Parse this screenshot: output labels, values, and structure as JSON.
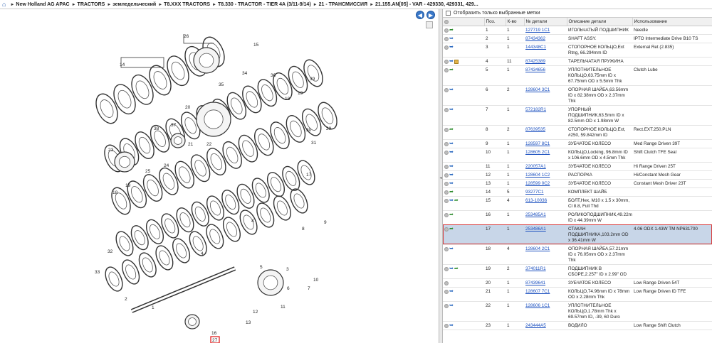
{
  "breadcrumb": {
    "home_icon": "home-icon",
    "items": [
      "New Holland AG APAC",
      "TRACTORS",
      "земледельческий",
      "T8.XXX TRACTORS",
      "T8.330 - TRACTOR - TIER 4A (3/11-9/14)",
      "21 - ТРАНСМИССИЯ",
      "21.155.AN[05] - VAR - 429330, 429331, 429..."
    ]
  },
  "diagram": {
    "labels": [
      "26",
      "15",
      "14",
      "36",
      "34",
      "35",
      "39",
      "19",
      "18",
      "20",
      "30",
      "37",
      "38",
      "22",
      "21",
      "31",
      "23",
      "25",
      "24",
      "29",
      "19",
      "18",
      "17",
      "9",
      "8",
      "4",
      "5",
      "6",
      "7",
      "32",
      "3",
      "33",
      "4",
      "10",
      "1",
      "2",
      "11",
      "12",
      "13",
      "16",
      "27"
    ],
    "highlighted_label": "27"
  },
  "nav": {
    "back": "◀",
    "forward": "▶"
  },
  "panel": {
    "filter_label": "Отобразить только выбранные метки",
    "columns": [
      "",
      "Поз.",
      "К-во",
      "№ детали",
      "Описание детали",
      "Использование"
    ]
  },
  "rows": [
    {
      "pos": "1",
      "qty": "1",
      "part": "127719 1C1",
      "desc": "ИГОЛЬЧАТЫЙ ПОДШИПНИК",
      "use": "Needle",
      "icons": "circ,arr"
    },
    {
      "pos": "2",
      "qty": "1",
      "part": "87434362",
      "desc": "SHAFT ASSY.",
      "use": "IPTO Intermediate Drive B10 TS",
      "icons": "circ,blue"
    },
    {
      "pos": "3",
      "qty": "1",
      "part": "144348C1",
      "desc": "СТОПОРНОЕ КОЛЬЦО,Ext Rtng, 66.294mm ID",
      "use": "External Ret (2.835)",
      "icons": "circ,blue"
    },
    {
      "pos": "4",
      "qty": "11",
      "part": "87425389",
      "desc": "ТАРЕЛЬЧАТАЯ ПРУЖИНА",
      "use": "",
      "icons": "circ,blue,box"
    },
    {
      "pos": "5",
      "qty": "1",
      "part": "87434656",
      "desc": "УПЛОТНИТЕЛЬНОЕ КОЛЬЦО,63.75mm ID x 67.75mm OD x 5.5mm Thk",
      "use": "Clutch Lube",
      "icons": "circ,arr"
    },
    {
      "pos": "6",
      "qty": "2",
      "part": "128604 3C1",
      "desc": "ОПОРНАЯ ШАЙБА,63.56mm ID x 82.38mm OD x 2.37mm Thk",
      "use": "",
      "icons": "circ,blue"
    },
    {
      "pos": "7",
      "qty": "1",
      "part": "572182R1",
      "desc": "УПОРНЫЙ ПОДШИПНИК,63.5mm ID x 82.5mm OD x 1.98mm W",
      "use": "",
      "icons": "circ,blue"
    },
    {
      "pos": "8",
      "qty": "2",
      "part": "87639535",
      "desc": "СТОПОРНОЕ КОЛЬЦО,Ext, #250, 59.842mm ID",
      "use": "Rect.EXT.250.PLN",
      "icons": "circ,arr"
    },
    {
      "pos": "9",
      "qty": "1",
      "part": "128597 8C1",
      "desc": "ЗУБЧАТОЕ КОЛЕСО",
      "use": "Med Range Driven 39T",
      "icons": "circ,blue"
    },
    {
      "pos": "10",
      "qty": "1",
      "part": "128605 2C1",
      "desc": "КОЛЬЦО,Locking, 96.8mm ID x 106.6mm OD x 4.5mm Thk",
      "use": "Shift Clutch TFE Seal",
      "icons": "circ,blue"
    },
    {
      "pos": "11",
      "qty": "1",
      "part": "220057A1",
      "desc": "ЗУБЧАТОЕ КОЛЕСО",
      "use": "Hi Range Driven 25T",
      "icons": "circ,blue"
    },
    {
      "pos": "12",
      "qty": "1",
      "part": "128604 1C2",
      "desc": "РАСПОРКА",
      "use": "Hi/Constant Mesh Gear",
      "icons": "circ,blue"
    },
    {
      "pos": "13",
      "qty": "1",
      "part": "128599 0C2",
      "desc": "ЗУБЧАТОЕ КОЛЕСО",
      "use": "Constant Mesh Driver 23T",
      "icons": "circ,blue"
    },
    {
      "pos": "14",
      "qty": "5",
      "part": "93277C1",
      "desc": "КОМПЛЕКТ ШАЙБ",
      "use": "",
      "icons": "circ,arr"
    },
    {
      "pos": "15",
      "qty": "4",
      "part": "613-10036",
      "desc": "БОЛТ,Hex, M10 x 1.5 x 30mm, Cl 8.8, Full Thd",
      "use": "",
      "icons": "circ,blue,arr"
    },
    {
      "pos": "16",
      "qty": "1",
      "part": "253485A1",
      "desc": "РОЛИКОПОДШИПНИК,49.22mm ID x 44.39mm W",
      "use": "",
      "icons": "circ,arr"
    },
    {
      "pos": "17",
      "qty": "1",
      "part": "253486A1",
      "desc": "СТАКАН ПОДШИПНИКА,103.2mm OD x 36.41mm W",
      "use": "4.06 ODX 1.43W TM NP631700",
      "icons": "circ,arr",
      "selected": true
    },
    {
      "pos": "18",
      "qty": "4",
      "part": "128604 2C1",
      "desc": "ОПОРНАЯ ШАЙБА,57.21mm ID x 76.05mm OD x 2.37mm Thk",
      "use": "",
      "icons": "circ,blue"
    },
    {
      "pos": "19",
      "qty": "2",
      "part": "374011R1",
      "desc": "ПОДШИПНИК В СБОРЕ,2.257\" ID x 2.99\" OD",
      "use": "",
      "icons": "circ,blue,arr"
    },
    {
      "pos": "20",
      "qty": "1",
      "part": "87439641",
      "desc": "ЗУБЧАТОЕ КОЛЕСО",
      "use": "Low Range Driven 54T",
      "icons": "circ"
    },
    {
      "pos": "21",
      "qty": "1",
      "part": "128607 7C1",
      "desc": "КОЛЬЦО,74.96mm ID x 78mm OD x 2.28mm Thk",
      "use": "Low Range Driven ID TFE",
      "icons": "circ,blue"
    },
    {
      "pos": "22",
      "qty": "1",
      "part": "128606 1C1",
      "desc": "УПЛОТНИТЕЛЬНОЕ КОЛЬЦО,1.78mm Thk x 69.57mm ID, -39, 60 Duro",
      "use": "",
      "icons": "circ,blue"
    },
    {
      "pos": "23",
      "qty": "1",
      "part": "243444A5",
      "desc": "ВОДИЛО",
      "use": "Low Range Shift Clutch",
      "icons": "circ,blue"
    }
  ]
}
